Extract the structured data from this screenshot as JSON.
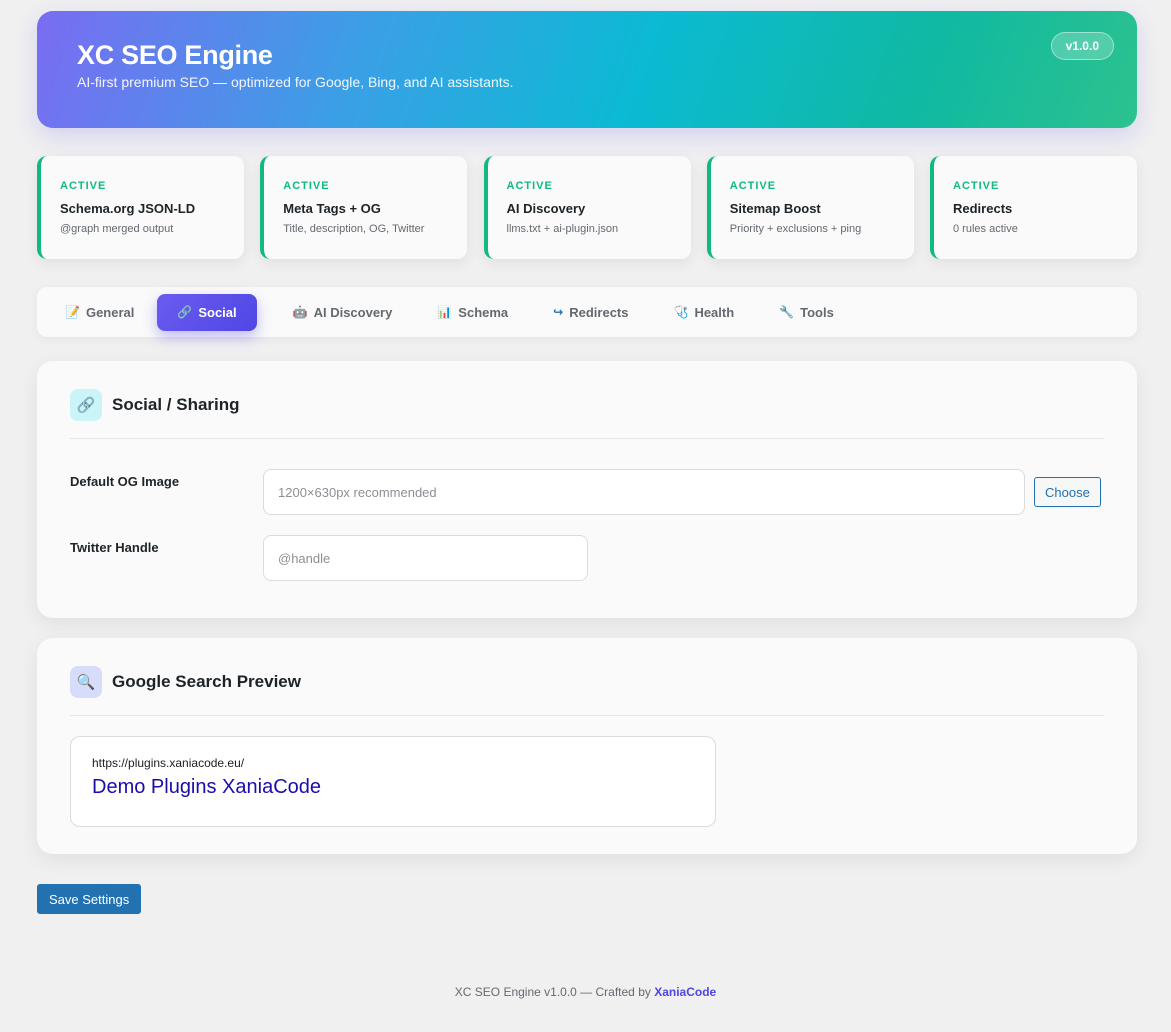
{
  "header": {
    "title": "XC SEO Engine",
    "subtitle": "AI-first premium SEO — optimized for Google, Bing, and AI assistants.",
    "version": "v1.0.0"
  },
  "status_cards": [
    {
      "status": "ACTIVE",
      "title": "Schema.org JSON-LD",
      "desc": "@graph merged output"
    },
    {
      "status": "ACTIVE",
      "title": "Meta Tags + OG",
      "desc": "Title, description, OG, Twitter"
    },
    {
      "status": "ACTIVE",
      "title": "AI Discovery",
      "desc": "llms.txt + ai-plugin.json"
    },
    {
      "status": "ACTIVE",
      "title": "Sitemap Boost",
      "desc": "Priority + exclusions + ping"
    },
    {
      "status": "ACTIVE",
      "title": "Redirects",
      "desc": "0 rules active"
    }
  ],
  "tabs": [
    {
      "icon": "📝",
      "label": "General"
    },
    {
      "icon": "🔗",
      "label": "Social"
    },
    {
      "icon": "🤖",
      "label": "AI Discovery"
    },
    {
      "icon": "📊",
      "label": "Schema"
    },
    {
      "icon": "↪",
      "label": "Redirects"
    },
    {
      "icon": "🩺",
      "label": "Health"
    },
    {
      "icon": "🔧",
      "label": "Tools"
    }
  ],
  "active_tab": "Social",
  "social_panel": {
    "icon": "🔗",
    "title": "Social / Sharing",
    "og_label": "Default OG Image",
    "og_placeholder": "1200×630px recommended",
    "og_value": "",
    "choose_label": "Choose",
    "twitter_label": "Twitter Handle",
    "twitter_placeholder": "@handle",
    "twitter_value": ""
  },
  "preview_panel": {
    "icon": "🔍",
    "title": "Google Search Preview",
    "url": "https://plugins.xaniacode.eu/",
    "page_title": "Demo Plugins XaniaCode"
  },
  "save_label": "Save Settings",
  "footer": {
    "text": "XC SEO Engine v1.0.0 — Crafted by",
    "link": "XaniaCode"
  },
  "colors": {
    "accent": "#4f46e5",
    "active_status": "#10b981",
    "wp_blue": "#2271b1",
    "link_title": "#1a0dab"
  }
}
